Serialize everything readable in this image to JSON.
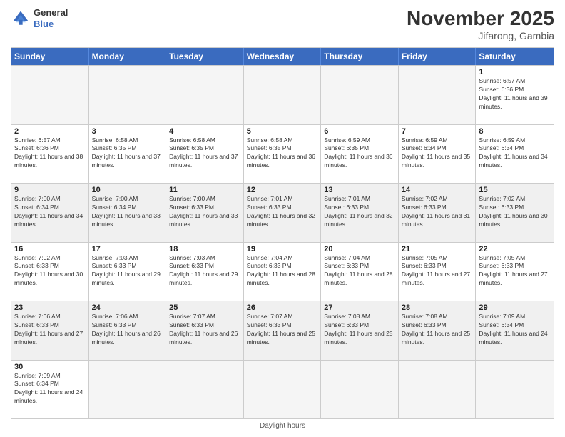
{
  "logo": {
    "line1": "General",
    "line2": "Blue"
  },
  "title": "November 2025",
  "location": "Jifarong, Gambia",
  "days_of_week": [
    "Sunday",
    "Monday",
    "Tuesday",
    "Wednesday",
    "Thursday",
    "Friday",
    "Saturday"
  ],
  "footer": "Daylight hours",
  "weeks": [
    [
      {
        "day": "",
        "empty": true
      },
      {
        "day": "",
        "empty": true
      },
      {
        "day": "",
        "empty": true
      },
      {
        "day": "",
        "empty": true
      },
      {
        "day": "",
        "empty": true
      },
      {
        "day": "",
        "empty": true
      },
      {
        "day": "1",
        "rise": "6:57 AM",
        "set": "6:36 PM",
        "daylight": "11 hours and 39 minutes."
      }
    ],
    [
      {
        "day": "2",
        "rise": "6:57 AM",
        "set": "6:36 PM",
        "daylight": "11 hours and 38 minutes."
      },
      {
        "day": "3",
        "rise": "6:58 AM",
        "set": "6:35 PM",
        "daylight": "11 hours and 37 minutes."
      },
      {
        "day": "4",
        "rise": "6:58 AM",
        "set": "6:35 PM",
        "daylight": "11 hours and 37 minutes."
      },
      {
        "day": "5",
        "rise": "6:58 AM",
        "set": "6:35 PM",
        "daylight": "11 hours and 36 minutes."
      },
      {
        "day": "6",
        "rise": "6:59 AM",
        "set": "6:35 PM",
        "daylight": "11 hours and 36 minutes."
      },
      {
        "day": "7",
        "rise": "6:59 AM",
        "set": "6:34 PM",
        "daylight": "11 hours and 35 minutes."
      },
      {
        "day": "8",
        "rise": "6:59 AM",
        "set": "6:34 PM",
        "daylight": "11 hours and 34 minutes."
      }
    ],
    [
      {
        "day": "9",
        "rise": "7:00 AM",
        "set": "6:34 PM",
        "daylight": "11 hours and 34 minutes."
      },
      {
        "day": "10",
        "rise": "7:00 AM",
        "set": "6:34 PM",
        "daylight": "11 hours and 33 minutes."
      },
      {
        "day": "11",
        "rise": "7:00 AM",
        "set": "6:33 PM",
        "daylight": "11 hours and 33 minutes."
      },
      {
        "day": "12",
        "rise": "7:01 AM",
        "set": "6:33 PM",
        "daylight": "11 hours and 32 minutes."
      },
      {
        "day": "13",
        "rise": "7:01 AM",
        "set": "6:33 PM",
        "daylight": "11 hours and 32 minutes."
      },
      {
        "day": "14",
        "rise": "7:02 AM",
        "set": "6:33 PM",
        "daylight": "11 hours and 31 minutes."
      },
      {
        "day": "15",
        "rise": "7:02 AM",
        "set": "6:33 PM",
        "daylight": "11 hours and 30 minutes."
      }
    ],
    [
      {
        "day": "16",
        "rise": "7:02 AM",
        "set": "6:33 PM",
        "daylight": "11 hours and 30 minutes."
      },
      {
        "day": "17",
        "rise": "7:03 AM",
        "set": "6:33 PM",
        "daylight": "11 hours and 29 minutes."
      },
      {
        "day": "18",
        "rise": "7:03 AM",
        "set": "6:33 PM",
        "daylight": "11 hours and 29 minutes."
      },
      {
        "day": "19",
        "rise": "7:04 AM",
        "set": "6:33 PM",
        "daylight": "11 hours and 28 minutes."
      },
      {
        "day": "20",
        "rise": "7:04 AM",
        "set": "6:33 PM",
        "daylight": "11 hours and 28 minutes."
      },
      {
        "day": "21",
        "rise": "7:05 AM",
        "set": "6:33 PM",
        "daylight": "11 hours and 27 minutes."
      },
      {
        "day": "22",
        "rise": "7:05 AM",
        "set": "6:33 PM",
        "daylight": "11 hours and 27 minutes."
      }
    ],
    [
      {
        "day": "23",
        "rise": "7:06 AM",
        "set": "6:33 PM",
        "daylight": "11 hours and 27 minutes."
      },
      {
        "day": "24",
        "rise": "7:06 AM",
        "set": "6:33 PM",
        "daylight": "11 hours and 26 minutes."
      },
      {
        "day": "25",
        "rise": "7:07 AM",
        "set": "6:33 PM",
        "daylight": "11 hours and 26 minutes."
      },
      {
        "day": "26",
        "rise": "7:07 AM",
        "set": "6:33 PM",
        "daylight": "11 hours and 25 minutes."
      },
      {
        "day": "27",
        "rise": "7:08 AM",
        "set": "6:33 PM",
        "daylight": "11 hours and 25 minutes."
      },
      {
        "day": "28",
        "rise": "7:08 AM",
        "set": "6:33 PM",
        "daylight": "11 hours and 25 minutes."
      },
      {
        "day": "29",
        "rise": "7:09 AM",
        "set": "6:34 PM",
        "daylight": "11 hours and 24 minutes."
      }
    ],
    [
      {
        "day": "30",
        "rise": "7:09 AM",
        "set": "6:34 PM",
        "daylight": "11 hours and 24 minutes."
      },
      {
        "day": "",
        "empty": true
      },
      {
        "day": "",
        "empty": true
      },
      {
        "day": "",
        "empty": true
      },
      {
        "day": "",
        "empty": true
      },
      {
        "day": "",
        "empty": true
      },
      {
        "day": "",
        "empty": true
      }
    ]
  ]
}
